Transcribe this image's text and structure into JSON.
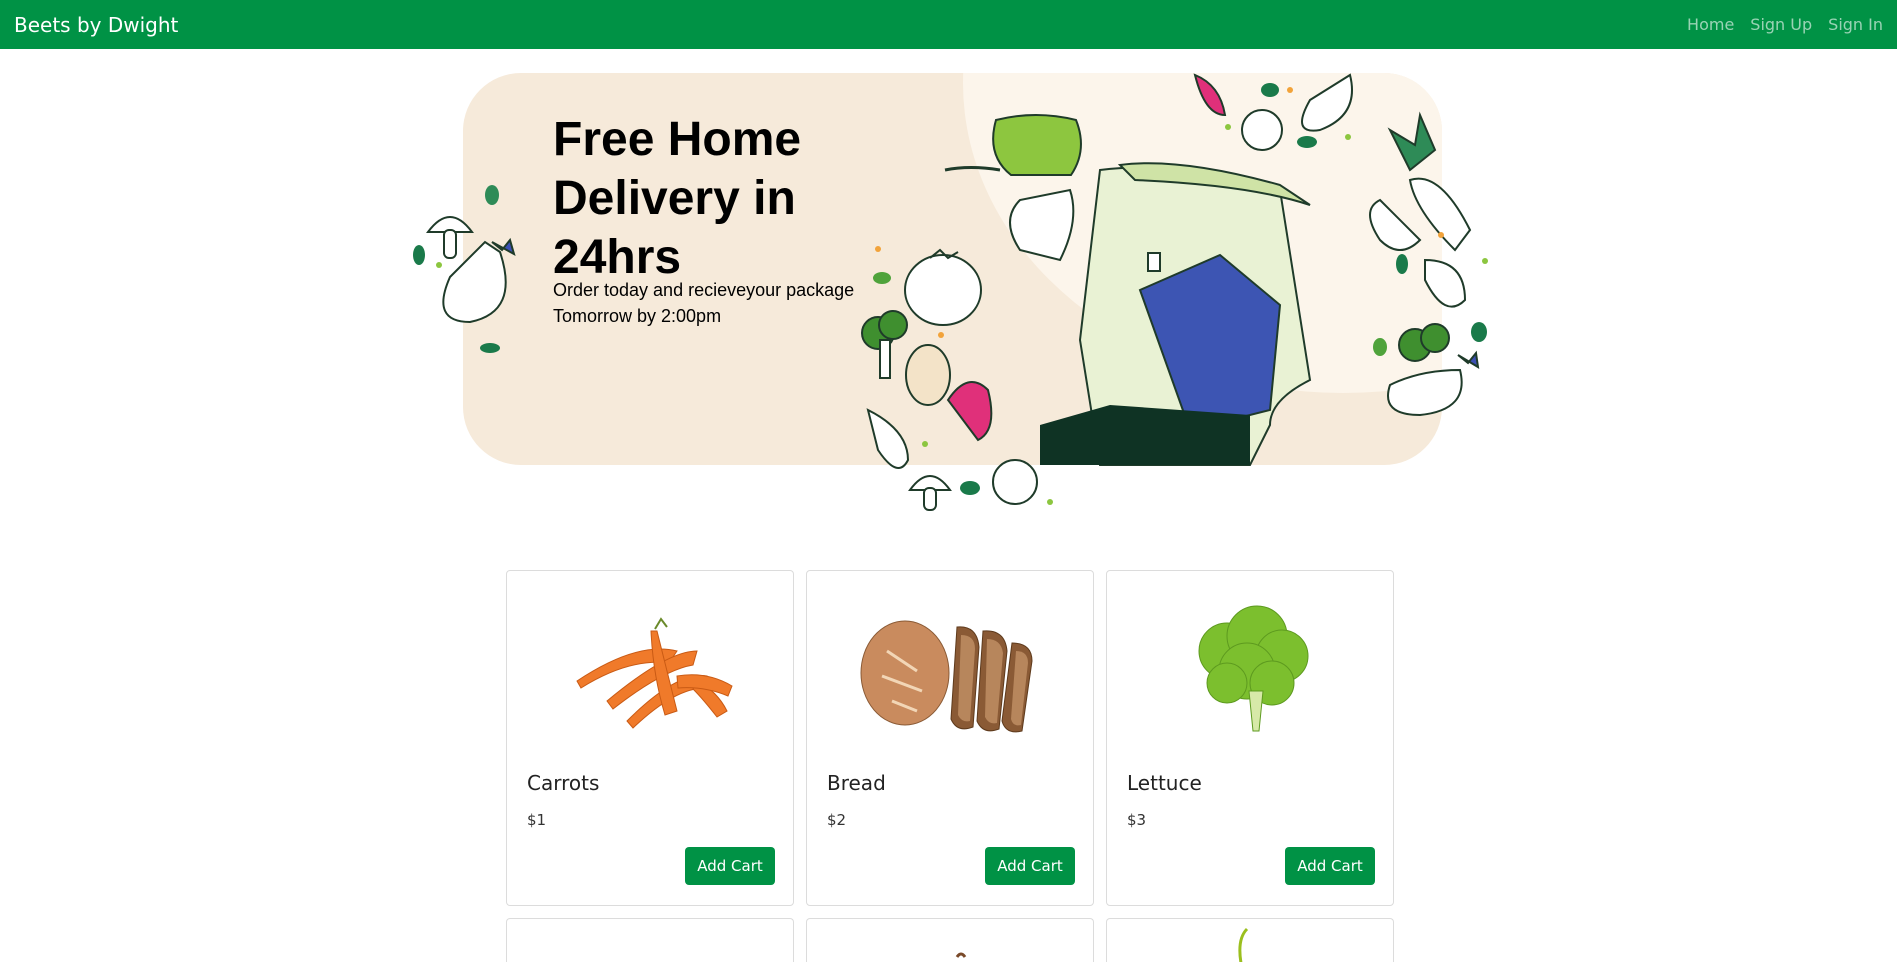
{
  "navbar": {
    "brand": "Beets by Dwight",
    "links": [
      "Home",
      "Sign Up",
      "Sign In"
    ],
    "bg_color": "#009245"
  },
  "hero": {
    "title": "Free Home Delivery in 24hrs",
    "subtitle": "Order today and recieveyour package Tomorrow by 2:00pm",
    "bg_color": "#f6eada"
  },
  "products": [
    {
      "name": "Carrots",
      "price": "$1",
      "button": "Add Cart",
      "image": "carrots-image"
    },
    {
      "name": "Bread",
      "price": "$2",
      "button": "Add Cart",
      "image": "bread-image"
    },
    {
      "name": "Lettuce",
      "price": "$3",
      "button": "Add Cart",
      "image": "lettuce-image"
    }
  ],
  "accent": "#009245"
}
